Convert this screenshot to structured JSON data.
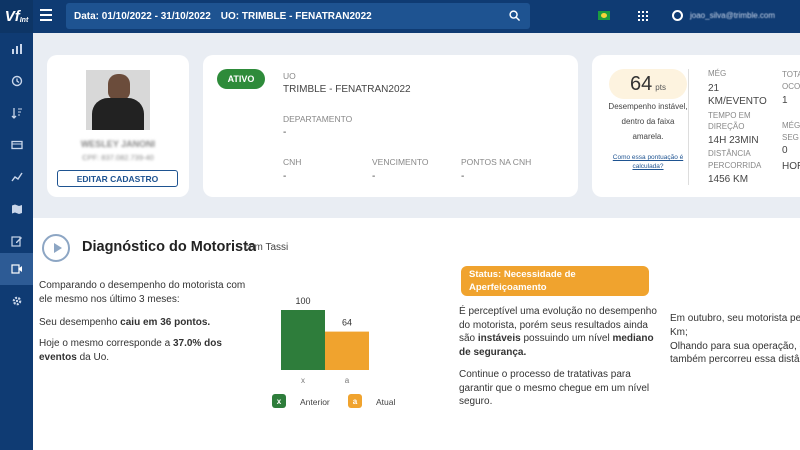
{
  "brand": {
    "logo": "Vf",
    "logo_sub": "Int"
  },
  "topbar": {
    "date_filter": "Data: 01/10/2022 - 31/10/2022",
    "uo_filter": "UO: TRIMBLE - FENATRAN2022",
    "user_email": "joao_silva@trimble.com"
  },
  "profile": {
    "name": "WESLEY JANONI",
    "cpf": "CPF: 837.082.739-40",
    "edit_button": "EDITAR CADASTRO"
  },
  "info": {
    "status": "ATIVO",
    "uo_label": "UO",
    "uo_value": "TRIMBLE - FENATRAN2022",
    "dept_label": "DEPARTAMENTO",
    "dept_value": "-",
    "cnh_label": "CNH",
    "cnh_value": "-",
    "venc_label": "VENCIMENTO",
    "venc_value": "-",
    "pontos_label": "PONTOS NA CNH",
    "pontos_value": "-"
  },
  "score": {
    "value": "64",
    "unit": "pts",
    "description": "Desempenho instável, dentro da faixa amarela.",
    "help_link": "Como essa pontuação é calculada?",
    "metric1_label": "MÉG",
    "metric1_value": "21 KM/EVENTO",
    "metric2_label": "TEMPO EM DIREÇÃO",
    "metric2_value": "14H 23MIN",
    "metric3_label": "DISTÂNCIA PERCORRIDA",
    "metric3_value": "1456 KM",
    "metric4_label": "TOTAL OCO",
    "metric4_value": "1",
    "metric5_label": "MÉG SEG",
    "metric5_value": "0",
    "metric6_value": "HOR"
  },
  "diagnostic": {
    "title": "Diagnóstico do Motorista",
    "subtitle": "com Tassi",
    "intro": "Comparando o desempenho do motorista com ele mesmo nos último 3 meses:",
    "drop_prefix": "Seu desempenho ",
    "drop_bold": "caiu em 36 pontos.",
    "corr_prefix": "Hoje o mesmo corresponde a ",
    "corr_bold": "37.0% dos eventos",
    "corr_suffix": " da Uo.",
    "status_label": "Status: Necessidade de Aperfeiçoamento",
    "analysis_p1_a": "É perceptível uma evolução no desempenho do motorista, porém seus resultados ainda são ",
    "analysis_p1_b": "instáveis",
    "analysis_p1_c": " possuindo um nível ",
    "analysis_p1_d": "mediano de segurança.",
    "analysis_p2": "Continue o processo de tratativas para garantir que o mesmo chegue em um nível seguro.",
    "right_text_1": "Em outubro, seu motorista pe",
    "right_text_2": "Km;",
    "right_text_3": "Olhando para sua operação, o",
    "right_text_4": "também percorreu essa distâ"
  },
  "chart_data": {
    "type": "bar",
    "categories": [
      "x",
      "a"
    ],
    "values": [
      100,
      64
    ],
    "legend": [
      "Anterior",
      "Atual"
    ],
    "legend_keys": [
      "x",
      "a"
    ],
    "colors": [
      "#2e7d3b",
      "#f0a32e"
    ],
    "ylim": [
      0,
      100
    ]
  }
}
